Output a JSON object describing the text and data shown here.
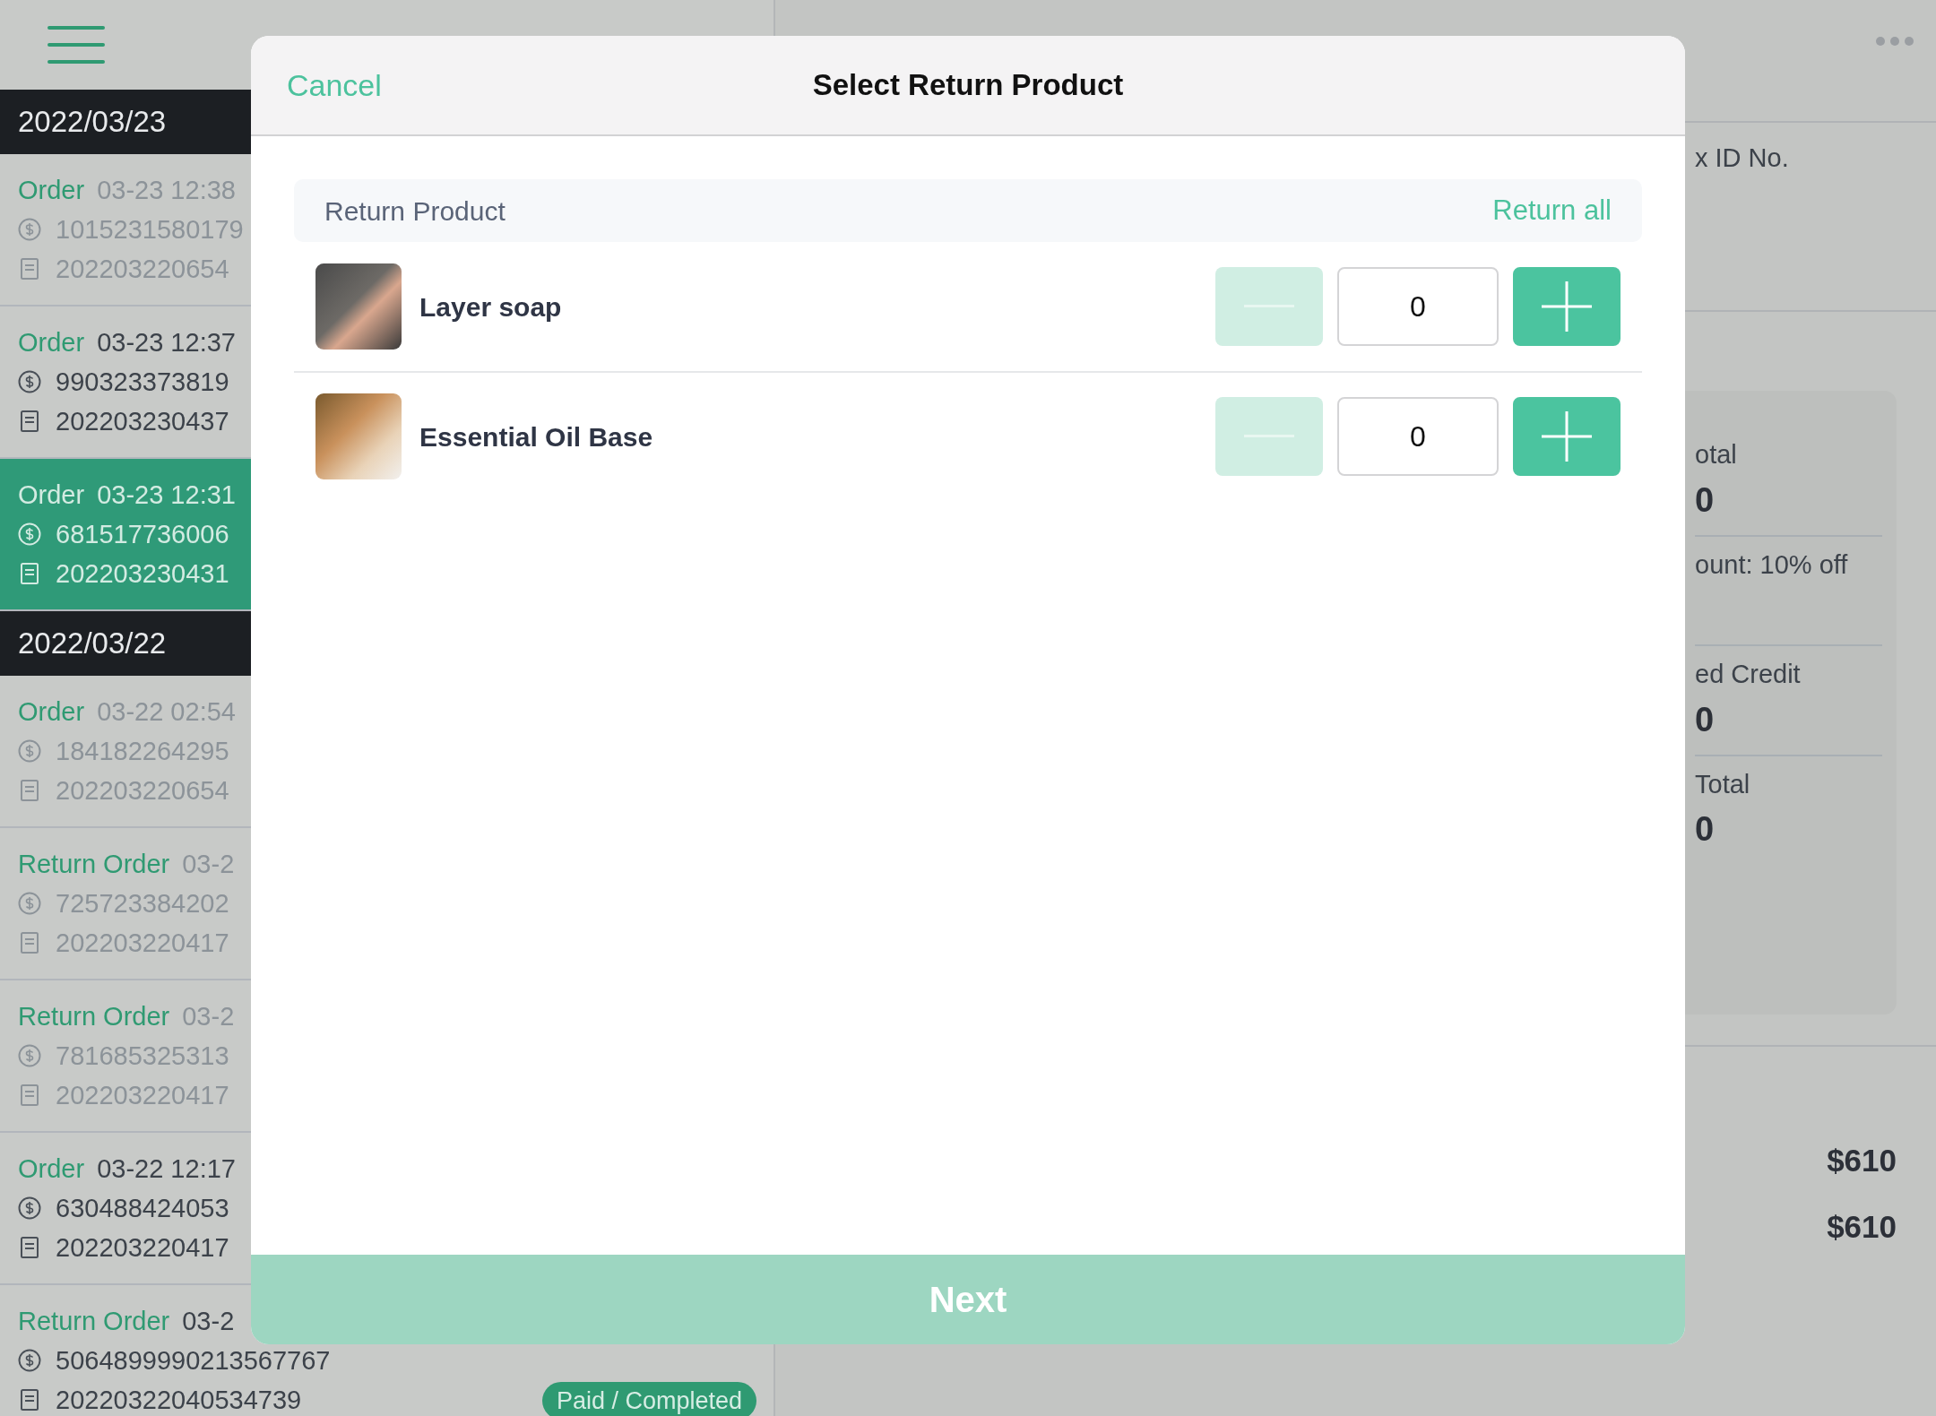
{
  "sidebar": {
    "groups": [
      {
        "date": "2022/03/23",
        "orders": [
          {
            "type": "Order",
            "time": "03-23 12:38",
            "payment_no": "1015231580179",
            "receipt_no": "202203220654",
            "muted": true,
            "selected": false
          },
          {
            "type": "Order",
            "time": "03-23 12:37",
            "payment_no": "990323373819",
            "receipt_no": "202203230437",
            "muted": false,
            "selected": false
          },
          {
            "type": "Order",
            "time": "03-23 12:31",
            "payment_no": "681517736006",
            "receipt_no": "202203230431",
            "muted": false,
            "selected": true
          }
        ]
      },
      {
        "date": "2022/03/22",
        "orders": [
          {
            "type": "Order",
            "time": "03-22 02:54",
            "payment_no": "184182264295",
            "receipt_no": "202203220654",
            "muted": true,
            "selected": false
          },
          {
            "type": "Return Order",
            "time": "03-2",
            "payment_no": "725723384202",
            "receipt_no": "202203220417",
            "muted": true,
            "selected": false
          },
          {
            "type": "Return Order",
            "time": "03-2",
            "payment_no": "781685325313",
            "receipt_no": "202203220417",
            "muted": true,
            "selected": false
          },
          {
            "type": "Order",
            "time": "03-22 12:17",
            "payment_no": "630488424053",
            "receipt_no": "202203220417",
            "muted": false,
            "selected": false
          },
          {
            "type": "Return Order",
            "time": "03-2",
            "payment_no": "5064899990213567767",
            "receipt_no": "20220322040534739",
            "muted": false,
            "selected": false,
            "status": "Paid / Completed"
          }
        ]
      }
    ]
  },
  "detail": {
    "tax_label": "x ID No.",
    "summary": [
      {
        "label": "otal",
        "value": "0"
      },
      {
        "label": "ount: 10% off"
      },
      {
        "label": "ed Credit",
        "value": "0"
      },
      {
        "label": "Total",
        "value": "0"
      }
    ],
    "amounts": [
      "$610",
      "$610"
    ]
  },
  "modal": {
    "cancel": "Cancel",
    "title": "Select Return Product",
    "section": "Return Product",
    "return_all": "Return all",
    "products": [
      {
        "name": "Layer soap",
        "quantity": "0",
        "minus_disabled": true
      },
      {
        "name": "Essential Oil Base",
        "quantity": "0",
        "minus_disabled": true
      }
    ],
    "next": {
      "label": "Next",
      "disabled": true
    }
  }
}
